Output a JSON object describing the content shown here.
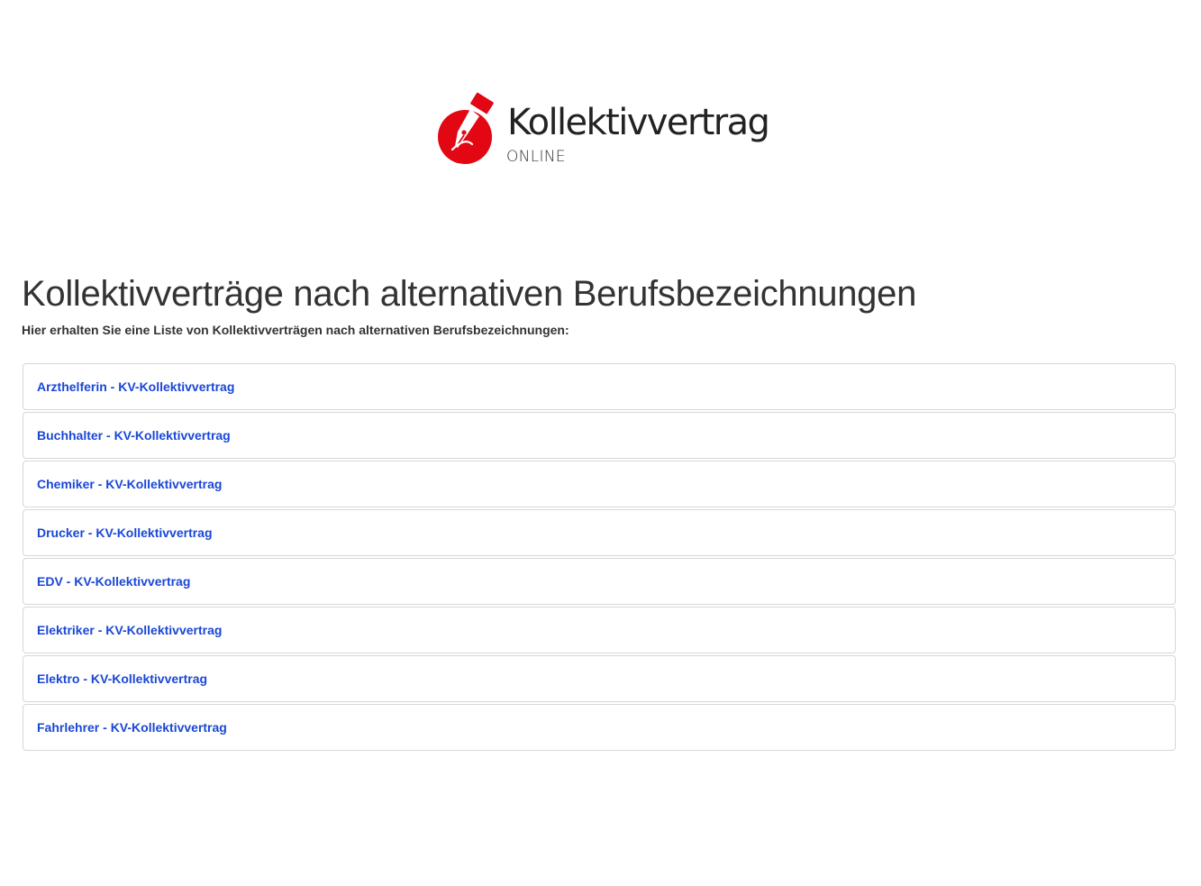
{
  "brand": {
    "name": "Kollektivvertrag",
    "subtitle": "ONLINE",
    "accent_color": "#e30613"
  },
  "page": {
    "title": "Kollektivverträge nach alternativen Berufsbezeichnungen",
    "intro": "Hier erhalten Sie eine Liste von Kollektivverträgen nach alternativen Berufsbezeichnungen:"
  },
  "items": [
    {
      "label": "Arzthelferin - KV-Kollektivvertrag"
    },
    {
      "label": "Buchhalter - KV-Kollektivvertrag"
    },
    {
      "label": "Chemiker - KV-Kollektivvertrag"
    },
    {
      "label": "Drucker - KV-Kollektivvertrag"
    },
    {
      "label": "EDV - KV-Kollektivvertrag"
    },
    {
      "label": "Elektriker - KV-Kollektivvertrag"
    },
    {
      "label": "Elektro - KV-Kollektivvertrag"
    },
    {
      "label": "Fahrlehrer - KV-Kollektivvertrag"
    }
  ],
  "colors": {
    "link": "#1a47d6",
    "border": "#d7d7d7"
  }
}
